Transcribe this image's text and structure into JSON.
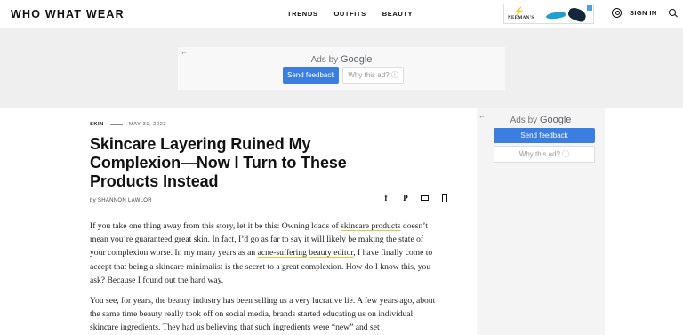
{
  "header": {
    "logo": "WHO WHAT WEAR",
    "nav": [
      "TRENDS",
      "OUTFITS",
      "BEAUTY"
    ],
    "ad_brand": "NEEMAN'S",
    "signin": "SIGN IN"
  },
  "top_ad": {
    "back": "←",
    "ads_by": "Ads by",
    "google": "Google",
    "send_feedback": "Send feedback",
    "why": "Why this ad? ⓘ"
  },
  "article": {
    "category": "SKIN",
    "date": "MAY 31, 2022",
    "title": "Skincare Layering Ruined My Complexion—Now I Turn to These Products Instead",
    "byline": "by SHANNON LAWLOR",
    "share": {
      "facebook": "f",
      "pinterest": "P"
    },
    "p1": {
      "a": "If you take one thing away from this story, let it be this: Owning loads of ",
      "link1": "skincare products",
      "b": " doesn’t mean you’re guaranteed great skin. In fact, I’d go as far to say it will likely be making the state of your complexion worse. In my many years as an ",
      "link2": "acne-suffering",
      "c": " ",
      "link3": "beauty editor",
      "d": ", I have finally come to accept that being a skincare minimalist is the secret to a great complexion. How do I know this, you ask? Because I found out the hard way."
    },
    "p2": "You see, for years, the beauty industry has been selling us a very lucrative lie. A few years ago, about the same time beauty really took off on social media, brands started educating us on individual skincare ingredients. They had us believing that such ingredients were “new” and set"
  },
  "rail_ad": {
    "back": "←",
    "ads_by": "Ads by",
    "google": "Google",
    "send_feedback": "Send feedback",
    "why": "Why this ad? ⓘ"
  }
}
